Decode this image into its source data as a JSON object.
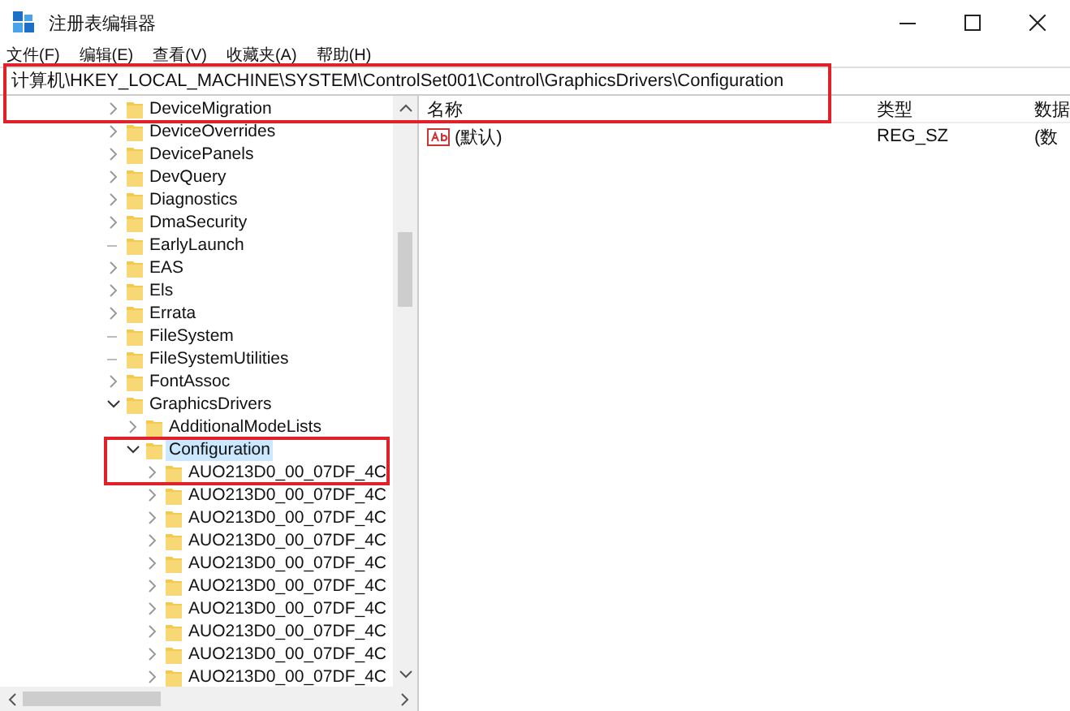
{
  "window": {
    "title": "注册表编辑器"
  },
  "menu": [
    {
      "label": "文件(F)"
    },
    {
      "label": "编辑(E)"
    },
    {
      "label": "查看(V)"
    },
    {
      "label": "收藏夹(A)"
    },
    {
      "label": "帮助(H)"
    }
  ],
  "address_bar": {
    "value": "计算机\\HKEY_LOCAL_MACHINE\\SYSTEM\\ControlSet001\\Control\\GraphicsDrivers\\Configuration",
    "highlighted": true
  },
  "tree": [
    {
      "label": "DeviceMigration",
      "has_children": true,
      "expanded": false,
      "selected": false
    },
    {
      "label": "DeviceOverrides",
      "has_children": true,
      "expanded": false,
      "selected": false
    },
    {
      "label": "DevicePanels",
      "has_children": true,
      "expanded": false,
      "selected": false
    },
    {
      "label": "DevQuery",
      "has_children": true,
      "expanded": false,
      "selected": false
    },
    {
      "label": "Diagnostics",
      "has_children": true,
      "expanded": false,
      "selected": false
    },
    {
      "label": "DmaSecurity",
      "has_children": true,
      "expanded": false,
      "selected": false
    },
    {
      "label": "EarlyLaunch",
      "has_children": false,
      "selected": false
    },
    {
      "label": "EAS",
      "has_children": true,
      "expanded": false,
      "selected": false
    },
    {
      "label": "Els",
      "has_children": true,
      "expanded": false,
      "selected": false
    },
    {
      "label": "Errata",
      "has_children": true,
      "expanded": false,
      "selected": false
    },
    {
      "label": "FileSystem",
      "has_children": false,
      "selected": false
    },
    {
      "label": "FileSystemUtilities",
      "has_children": false,
      "selected": false
    },
    {
      "label": "FontAssoc",
      "has_children": true,
      "expanded": false,
      "selected": false
    },
    {
      "label": "GraphicsDrivers",
      "has_children": true,
      "expanded": true,
      "selected": false,
      "children": [
        {
          "label": "AdditionalModeLists",
          "has_children": true,
          "expanded": false,
          "selected": false
        },
        {
          "label": "Configuration",
          "has_children": true,
          "expanded": true,
          "selected": true,
          "highlighted": true,
          "children": [
            {
              "label": "AUO213D0_00_07DF_4C",
              "has_children": true,
              "expanded": false,
              "selected": false,
              "highlighted": true
            },
            {
              "label": "AUO213D0_00_07DF_4C",
              "has_children": true,
              "expanded": false,
              "selected": false
            },
            {
              "label": "AUO213D0_00_07DF_4C",
              "has_children": true,
              "expanded": false,
              "selected": false
            },
            {
              "label": "AUO213D0_00_07DF_4C",
              "has_children": true,
              "expanded": false,
              "selected": false
            },
            {
              "label": "AUO213D0_00_07DF_4C",
              "has_children": true,
              "expanded": false,
              "selected": false
            },
            {
              "label": "AUO213D0_00_07DF_4C",
              "has_children": true,
              "expanded": false,
              "selected": false
            },
            {
              "label": "AUO213D0_00_07DF_4C",
              "has_children": true,
              "expanded": false,
              "selected": false
            },
            {
              "label": "AUO213D0_00_07DF_4C",
              "has_children": true,
              "expanded": false,
              "selected": false
            },
            {
              "label": "AUO213D0_00_07DF_4C",
              "has_children": true,
              "expanded": false,
              "selected": false
            },
            {
              "label": "AUO213D0_00_07DF_4C",
              "has_children": true,
              "expanded": false,
              "selected": false
            }
          ]
        }
      ]
    }
  ],
  "values": {
    "columns": [
      "名称",
      "类型",
      "数据"
    ],
    "rows": [
      {
        "name": "(默认)",
        "type": "REG_SZ",
        "data": "(数"
      }
    ]
  }
}
